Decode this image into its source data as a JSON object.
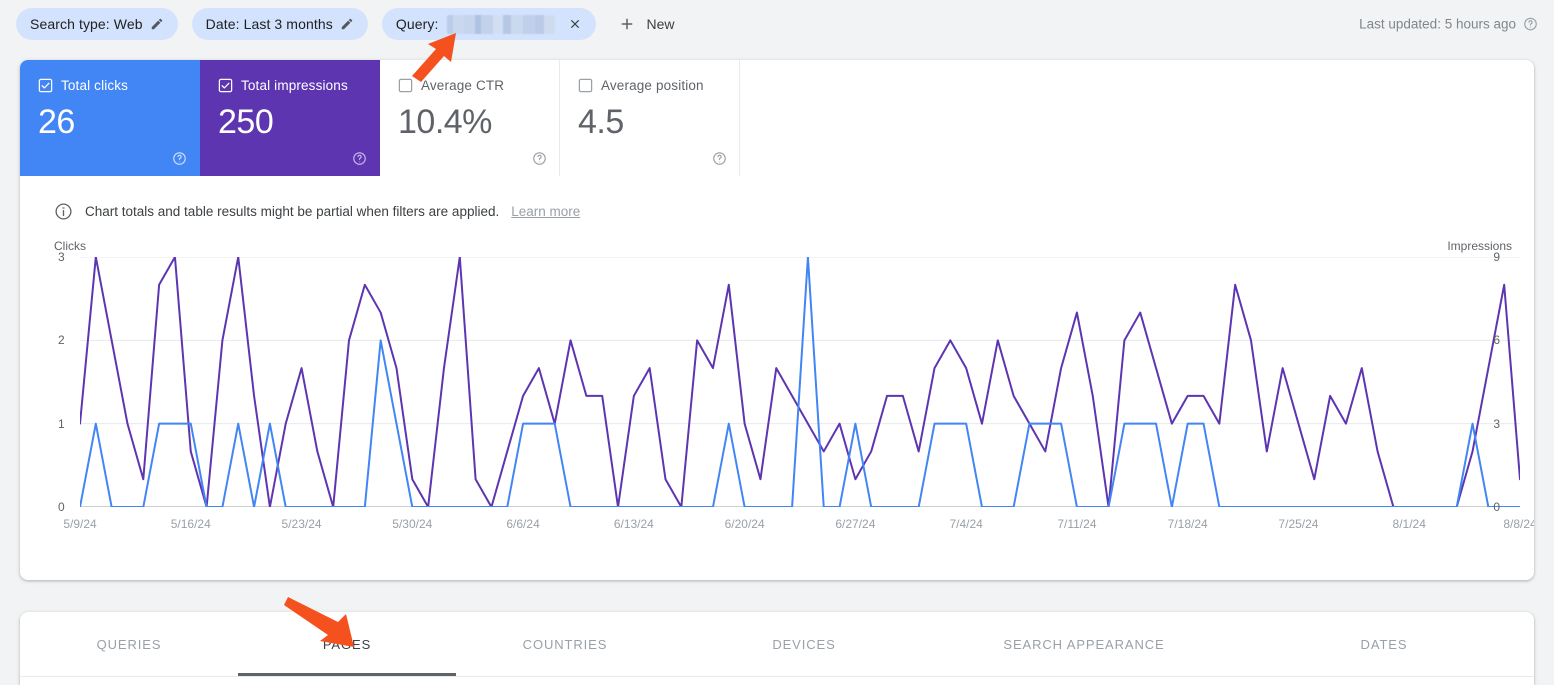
{
  "filters": {
    "search_type": {
      "label": "Search type: Web",
      "edit_icon": "pencil-icon"
    },
    "date": {
      "label": "Date: Last 3 months",
      "edit_icon": "pencil-icon"
    },
    "query": {
      "label": "Query:",
      "value_redacted": true,
      "close_icon": "close-icon"
    },
    "new_button": {
      "label": "New",
      "icon": "plus-icon"
    },
    "last_updated": {
      "label": "Last updated: 5 hours ago",
      "help_icon": "help-icon"
    }
  },
  "metrics": [
    {
      "label": "Total clicks",
      "value": "26",
      "checked": true,
      "style": "sel-blue",
      "color": "#4285F4"
    },
    {
      "label": "Total impressions",
      "value": "250",
      "checked": true,
      "style": "sel-purple",
      "color": "#5E35B1"
    },
    {
      "label": "Average CTR",
      "value": "10.4%",
      "checked": false,
      "style": "",
      "color": "#5f6368"
    },
    {
      "label": "Average position",
      "value": "4.5",
      "checked": false,
      "style": "",
      "color": "#5f6368"
    }
  ],
  "banner": {
    "text": "Chart totals and table results might be partial when filters are applied.",
    "link": "Learn more",
    "icon": "info-icon"
  },
  "tabs": [
    {
      "label": "QUERIES",
      "active": false
    },
    {
      "label": "PAGES",
      "active": true
    },
    {
      "label": "COUNTRIES",
      "active": false
    },
    {
      "label": "DEVICES",
      "active": false
    },
    {
      "label": "SEARCH APPEARANCE",
      "active": false
    },
    {
      "label": "DATES",
      "active": false
    }
  ],
  "annotations": [
    {
      "name": "arrow-to-query-filter",
      "color": "#F4511E",
      "direction": "up-right"
    },
    {
      "name": "arrow-to-pages-tab",
      "color": "#F4511E",
      "direction": "down-right"
    }
  ],
  "chart_data": {
    "type": "line",
    "title": "",
    "xlabel": "",
    "ylabel": "Clicks",
    "y2label": "Impressions",
    "grid": true,
    "legend": "none",
    "ylim": [
      0,
      3
    ],
    "y2lim": [
      0,
      9
    ],
    "yticks": [
      "0",
      "1",
      "2",
      "3"
    ],
    "y2ticks": [
      "0",
      "3",
      "6",
      "9"
    ],
    "xticks": [
      "5/9/24",
      "5/16/24",
      "5/23/24",
      "5/30/24",
      "6/6/24",
      "6/13/24",
      "6/20/24",
      "6/27/24",
      "7/4/24",
      "7/11/24",
      "7/18/24",
      "7/25/24",
      "8/1/24",
      "8/8/24"
    ],
    "xtick_indices": [
      0,
      7,
      14,
      21,
      28,
      35,
      42,
      49,
      56,
      63,
      70,
      77,
      84,
      91
    ],
    "x_start": "5/9/24",
    "x_end": "8/8/24",
    "n_points": 92,
    "series": [
      {
        "name": "Clicks",
        "color": "#4285F4",
        "axis": "left",
        "values": [
          0,
          1,
          0,
          0,
          0,
          1,
          1,
          1,
          0,
          0,
          1,
          0,
          1,
          0,
          0,
          0,
          0,
          0,
          0,
          2,
          1,
          0,
          0,
          0,
          0,
          0,
          0,
          0,
          1,
          1,
          1,
          0,
          0,
          0,
          0,
          0,
          0,
          0,
          0,
          0,
          0,
          1,
          0,
          0,
          0,
          0,
          3,
          0,
          0,
          1,
          0,
          0,
          0,
          0,
          1,
          1,
          1,
          0,
          0,
          0,
          1,
          1,
          1,
          0,
          0,
          0,
          1,
          1,
          1,
          0,
          1,
          1,
          0,
          0,
          0,
          0,
          0,
          0,
          0,
          0,
          0,
          0,
          0,
          0,
          0,
          0,
          0,
          0,
          1,
          0,
          0,
          0
        ]
      },
      {
        "name": "Impressions",
        "color": "#5E35B1",
        "axis": "right",
        "values": [
          3,
          9,
          6,
          3,
          1,
          8,
          9,
          2,
          0,
          6,
          9,
          4,
          0,
          3,
          5,
          2,
          0,
          6,
          8,
          7,
          5,
          1,
          0,
          5,
          9,
          1,
          0,
          2,
          4,
          5,
          3,
          6,
          4,
          4,
          0,
          4,
          5,
          1,
          0,
          6,
          5,
          8,
          3,
          1,
          5,
          4,
          3,
          2,
          3,
          1,
          2,
          4,
          4,
          2,
          5,
          6,
          5,
          3,
          6,
          4,
          3,
          2,
          5,
          7,
          4,
          0,
          6,
          7,
          5,
          3,
          4,
          4,
          3,
          8,
          6,
          2,
          5,
          3,
          1,
          4,
          3,
          5,
          2,
          0,
          0,
          0,
          0,
          0,
          2,
          5,
          8,
          1
        ]
      }
    ]
  }
}
